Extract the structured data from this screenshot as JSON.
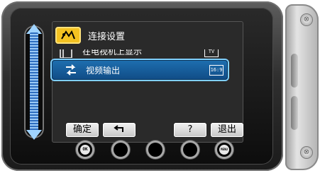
{
  "menu": {
    "header_title": "连接设置",
    "header_icon": "connection-settings-icon",
    "items": [
      {
        "label": "在电视机上显示",
        "icon": "tv-display-icon",
        "badge": "TV"
      },
      {
        "label": "视频输出",
        "icon": "video-output-icon",
        "badge": "16:9",
        "selected": true
      }
    ]
  },
  "softkeys": {
    "confirm": "确定",
    "back_icon": "return-arrow-icon",
    "help": "?",
    "exit": "退出"
  },
  "hardware_buttons": {
    "ok": "OK",
    "menu": "MENU"
  },
  "colors": {
    "header_icon_bg": "#f4c221",
    "selection_bg": "#1e6fb0",
    "selection_border": "#7fd0ff",
    "slider_track": "#2d6dbf"
  }
}
